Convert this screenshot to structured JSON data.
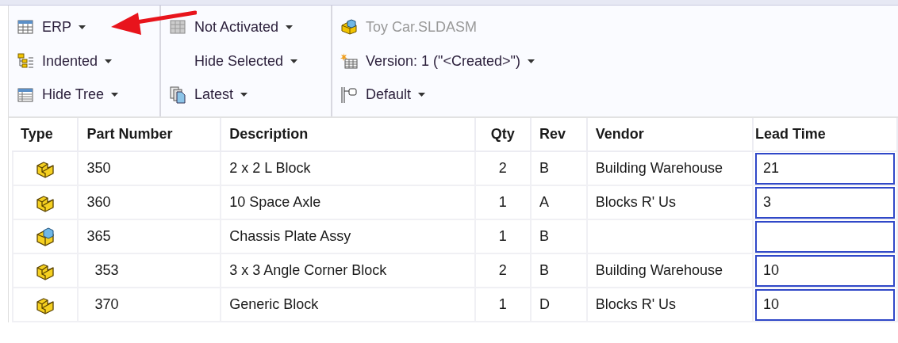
{
  "toolbar": {
    "groups": [
      {
        "items": [
          {
            "label": "ERP",
            "dropdown": true,
            "disabled": false
          },
          {
            "label": "Indented",
            "dropdown": true,
            "disabled": false
          },
          {
            "label": "Hide Tree",
            "dropdown": true,
            "disabled": false
          }
        ]
      },
      {
        "items": [
          {
            "label": "Not Activated",
            "dropdown": true,
            "disabled": false
          },
          {
            "label": "Hide Selected",
            "dropdown": true,
            "disabled": false
          },
          {
            "label": "Latest",
            "dropdown": true,
            "disabled": false
          }
        ]
      },
      {
        "items": [
          {
            "label": "Toy Car.SLDASM",
            "dropdown": false,
            "disabled": true
          },
          {
            "label": "Version: 1 (\"<Created>\")",
            "dropdown": true,
            "disabled": false
          },
          {
            "label": "Default",
            "dropdown": true,
            "disabled": false
          }
        ]
      }
    ]
  },
  "annotation": {
    "kind": "arrow"
  },
  "table": {
    "columns": [
      "Type",
      "Part Number",
      "Description",
      "Qty",
      "Rev",
      "Vendor",
      "Lead Time"
    ],
    "rows": [
      {
        "kind": "part",
        "part_number": "350",
        "description": "2 x 2 L Block",
        "qty": "2",
        "rev": "B",
        "vendor": "Building Warehouse",
        "lead_time": "21"
      },
      {
        "kind": "part",
        "part_number": "360",
        "description": "10 Space Axle",
        "qty": "1",
        "rev": "A",
        "vendor": "Blocks R' Us",
        "lead_time": "3"
      },
      {
        "kind": "assembly",
        "part_number": "365",
        "description": "Chassis Plate Assy",
        "qty": "1",
        "rev": "B",
        "children": [
          {
            "kind": "part",
            "part_number": "353",
            "description": "3 x 3 Angle Corner Block",
            "qty": "2",
            "rev": "B",
            "vendor": "Building Warehouse",
            "lead_time": "10"
          },
          {
            "kind": "part",
            "part_number": "370",
            "description": "Generic Block",
            "qty": "1",
            "rev": "D",
            "vendor": "Blocks R' Us",
            "lead_time": "10"
          }
        ]
      }
    ]
  }
}
